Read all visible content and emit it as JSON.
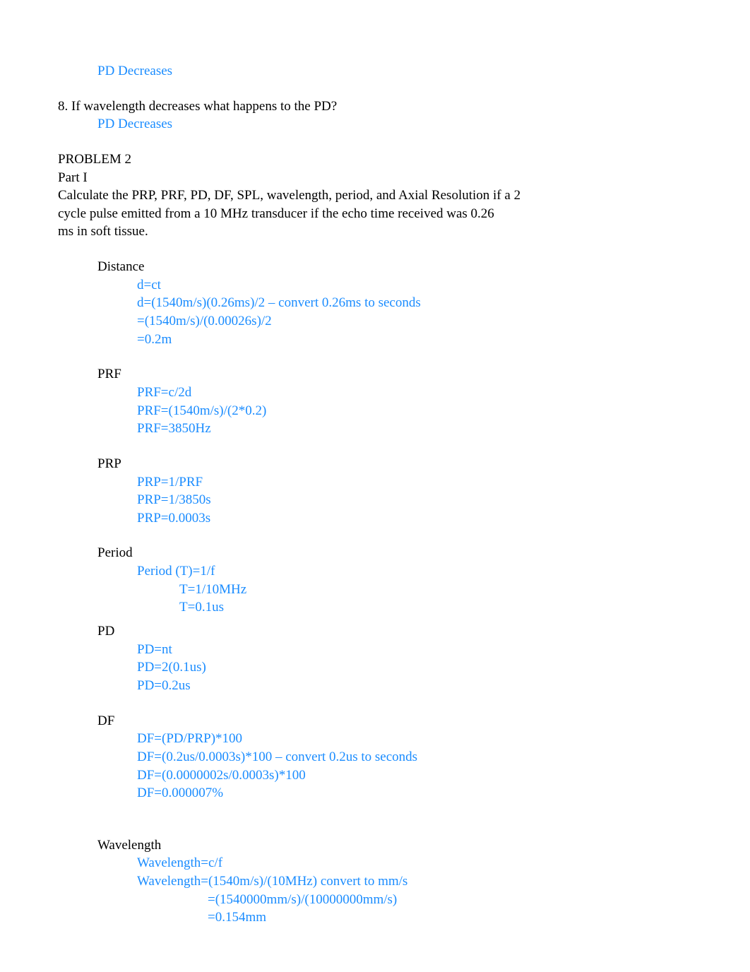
{
  "q7_answer": "PD Decreases",
  "q8": {
    "question": "8. If wavelength decreases what happens to the PD?",
    "answer": "PD Decreases"
  },
  "problem2": {
    "title": "PROBLEM 2",
    "part_label": "Part I",
    "prompt_line1": "Calculate the PRP, PRF, PD, DF, SPL, wavelength, period, and Axial Resolution if a 2",
    "prompt_line2": "cycle pulse emitted from a 10 MHz transducer if the echo time received was 0.26",
    "prompt_line3": "ms in soft tissue.",
    "sections": {
      "distance": {
        "heading": "Distance",
        "l1": "d=ct",
        "l2": "d=(1540m/s)(0.26ms)/2 – convert 0.26ms to seconds",
        "l3": "=(1540m/s)/(0.00026s)/2",
        "l4": "=0.2m"
      },
      "prf": {
        "heading": "PRF",
        "l1": "PRF=c/2d",
        "l2": "PRF=(1540m/s)/(2*0.2)",
        "l3": "PRF=3850Hz"
      },
      "prp": {
        "heading": "PRP",
        "l1": "PRP=1/PRF",
        "l2": "PRP=1/3850s",
        "l3": "PRP=0.0003s"
      },
      "period": {
        "heading": "Period",
        "l1": "Period (T)=1/f",
        "l2": "T=1/10MHz",
        "l3": "T=0.1us"
      },
      "pd": {
        "heading": "PD",
        "l1": "PD=nt",
        "l2": "PD=2(0.1us)",
        "l3": "PD=0.2us"
      },
      "df": {
        "heading": "DF",
        "l1": "DF=(PD/PRP)*100",
        "l2": "DF=(0.2us/0.0003s)*100 – convert 0.2us to seconds",
        "l3": "DF=(0.0000002s/0.0003s)*100",
        "l4": "DF=0.000007%"
      },
      "wavelength": {
        "heading": "Wavelength",
        "l1": "Wavelength=c/f",
        "l2": "Wavelength=(1540m/s)/(10MHz) convert to mm/s",
        "l3": "=(1540000mm/s)/(10000000mm/s)",
        "l4": "=0.154mm"
      }
    }
  }
}
